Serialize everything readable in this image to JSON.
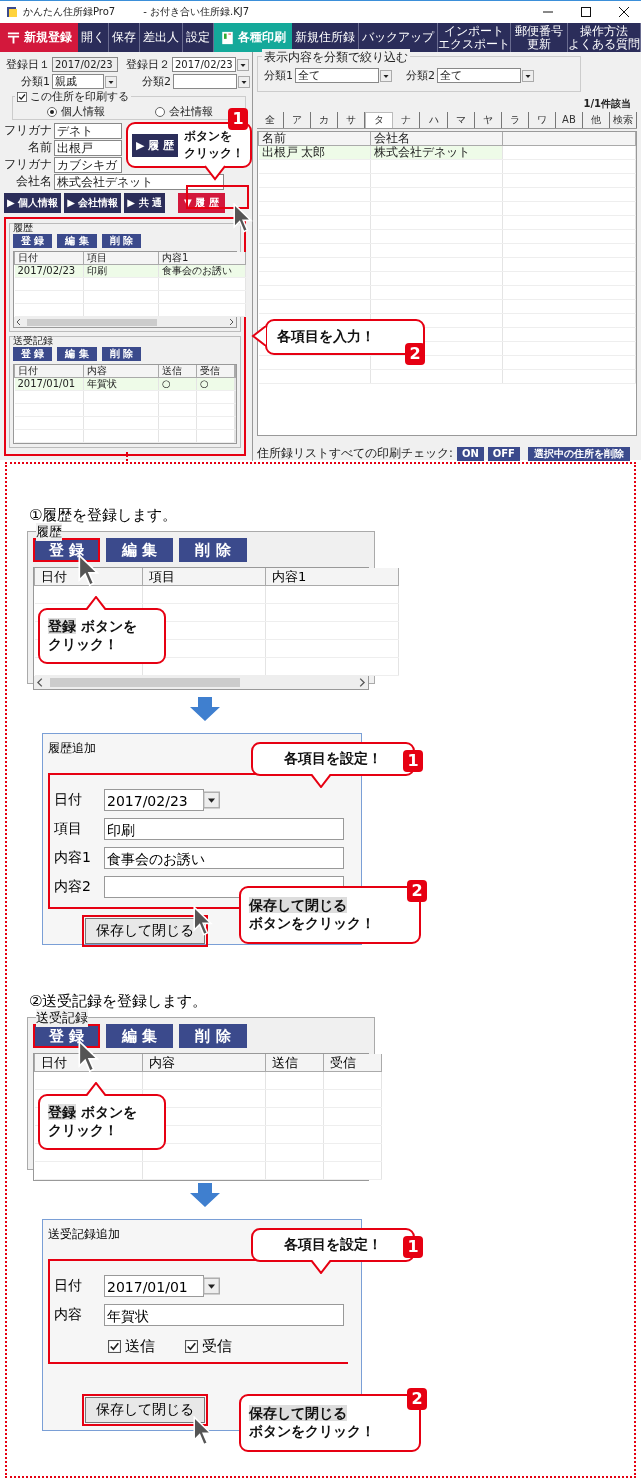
{
  "window": {
    "title": "かんたん住所録Pro7",
    "file": "- お付き合い住所録.KJ7"
  },
  "toolbar": [
    {
      "kind": "primary",
      "label": "新規登録"
    },
    {
      "kind": "plain",
      "label": "開く"
    },
    {
      "kind": "plain",
      "label": "保存"
    },
    {
      "kind": "plain",
      "label": "差出人"
    },
    {
      "kind": "plain",
      "label": "設定"
    },
    {
      "kind": "print",
      "label": "各種印刷"
    },
    {
      "kind": "plain",
      "label": "新規住所録"
    },
    {
      "kind": "plain",
      "label": "バックアップ"
    },
    {
      "kind": "small",
      "lines": [
        "インポート",
        "エクスポート"
      ]
    },
    {
      "kind": "small",
      "lines": [
        "郵便番号",
        "更新"
      ]
    },
    {
      "kind": "small",
      "lines": [
        "操作方法",
        "よくある質問"
      ]
    }
  ],
  "form": {
    "date1": {
      "label": "登録日１",
      "value": "2017/02/23"
    },
    "date2": {
      "label": "登録日２",
      "value": "2017/02/23"
    },
    "category1": {
      "label": "分類1",
      "value": "親戚"
    },
    "category2": {
      "label": "分類2"
    },
    "print_check": {
      "label": "この住所を印刷する",
      "checked": true
    },
    "radios": [
      {
        "label": "個人情報",
        "selected": true
      },
      {
        "label": "会社情報",
        "selected": false
      }
    ],
    "fields": [
      {
        "label": "フリガナ",
        "value": "デネト"
      },
      {
        "label": "名前",
        "value": "出根戸"
      },
      {
        "label": "フリガナ",
        "value": "カブシキガ"
      },
      {
        "label": "会社名",
        "value": "株式会社デネット"
      }
    ],
    "tabs": [
      {
        "label": "▶ 個人情報",
        "selected": false
      },
      {
        "label": "▶ 会社情報",
        "selected": false
      },
      {
        "label": "▶ 共 通",
        "selected": false
      },
      {
        "label": "▼ 履 歴",
        "selected": true
      }
    ]
  },
  "history": {
    "title": "履歴",
    "buttons": [
      "登 録",
      "編 集",
      "削 除"
    ],
    "columns": [
      "日付",
      "項目",
      "内容1"
    ],
    "rows": [
      [
        "2017/02/23",
        "印刷",
        "食事会のお誘い"
      ]
    ]
  },
  "send_receive": {
    "title": "送受記録",
    "buttons": [
      "登 録",
      "編 集",
      "削 除"
    ],
    "columns": [
      "日付",
      "内容",
      "送信",
      "受信"
    ],
    "rows": [
      [
        "2017/01/01",
        "年賀状",
        "○",
        "○"
      ]
    ]
  },
  "filter": {
    "title": "表示内容を分類で絞り込む",
    "category1": {
      "label": "分類1",
      "value": "全て"
    },
    "category2": {
      "label": "分類2",
      "value": "全て"
    }
  },
  "count": "1/1件該当",
  "index_tabs": [
    {
      "label": "全",
      "selected": false
    },
    {
      "label": "ア",
      "selected": false
    },
    {
      "label": "カ",
      "selected": false
    },
    {
      "label": "サ",
      "selected": false
    },
    {
      "label": "タ",
      "selected": true
    },
    {
      "label": "ナ",
      "selected": false
    },
    {
      "label": "ハ",
      "selected": false
    },
    {
      "label": "マ",
      "selected": false
    },
    {
      "label": "ヤ",
      "selected": false
    },
    {
      "label": "ラ",
      "selected": false
    },
    {
      "label": "ワ",
      "selected": false
    },
    {
      "label": "AB",
      "selected": false
    },
    {
      "label": "他",
      "selected": false
    },
    {
      "label": "検索",
      "selected": false
    }
  ],
  "list": {
    "columns": [
      "名前",
      "会社名"
    ],
    "rows": [
      [
        "出根戸 太郎",
        "株式会社デネット"
      ]
    ]
  },
  "bottom_bar": {
    "label": "住所録リストすべての印刷チェック:",
    "buttons": [
      "ON",
      "OFF",
      "選択中の住所を削除"
    ]
  },
  "callouts": [
    {
      "number": "1",
      "button": "▶ 履 歴",
      "lines": [
        {
          "text": "ボタンを"
        },
        {
          "text": "クリック！"
        }
      ]
    },
    {
      "number": "2",
      "lines": [
        {
          "text": "各項目を入力！"
        }
      ]
    }
  ],
  "steps": [
    {
      "heading": "①履歴を登録します。",
      "group_title": "履歴",
      "buttons": [
        "登 録",
        "編 集",
        "削 除"
      ],
      "columns": [
        "日付",
        "項目",
        "内容1"
      ],
      "callout": {
        "lines": [
          {
            "highlight": "登録",
            "text": "ボタンを"
          },
          {
            "text": "クリック！"
          }
        ]
      },
      "dialog": {
        "title": "履歴追加",
        "fields": [
          {
            "kind": "date",
            "label": "日付",
            "value": "2017/02/23"
          },
          {
            "kind": "text",
            "label": "項目",
            "value": "印刷"
          },
          {
            "kind": "text",
            "label": "内容1",
            "value": "食事会のお誘い"
          },
          {
            "kind": "text",
            "label": "内容2"
          }
        ],
        "save": "保存して閉じる",
        "callout1": {
          "number": "1",
          "lines": [
            {
              "text": "各項目を設定！"
            }
          ]
        },
        "callout2": {
          "number": "2",
          "lines": [
            {
              "highlight": "保存して閉じる"
            },
            {
              "text": "ボタンをクリック！"
            }
          ]
        }
      }
    },
    {
      "heading": "②送受記録を登録します。",
      "group_title": "送受記録",
      "buttons": [
        "登 録",
        "編 集",
        "削 除"
      ],
      "columns": [
        "日付",
        "内容",
        "送信",
        "受信"
      ],
      "callout": {
        "lines": [
          {
            "highlight": "登録",
            "text": "ボタンを"
          },
          {
            "text": "クリック！"
          }
        ]
      },
      "dialog": {
        "title": "送受記録追加",
        "fields": [
          {
            "kind": "date",
            "label": "日付",
            "value": "2017/01/01"
          },
          {
            "kind": "text",
            "label": "内容",
            "value": "年賀状"
          }
        ],
        "checks": [
          {
            "label": "送信",
            "checked": true
          },
          {
            "label": "受信",
            "checked": true
          }
        ],
        "save": "保存して閉じる",
        "callout1": {
          "number": "1",
          "lines": [
            {
              "text": "各項目を設定！"
            }
          ]
        },
        "callout2": {
          "number": "2",
          "lines": [
            {
              "highlight": "保存して閉じる"
            },
            {
              "text": "ボタンをクリック！"
            }
          ]
        }
      }
    }
  ]
}
